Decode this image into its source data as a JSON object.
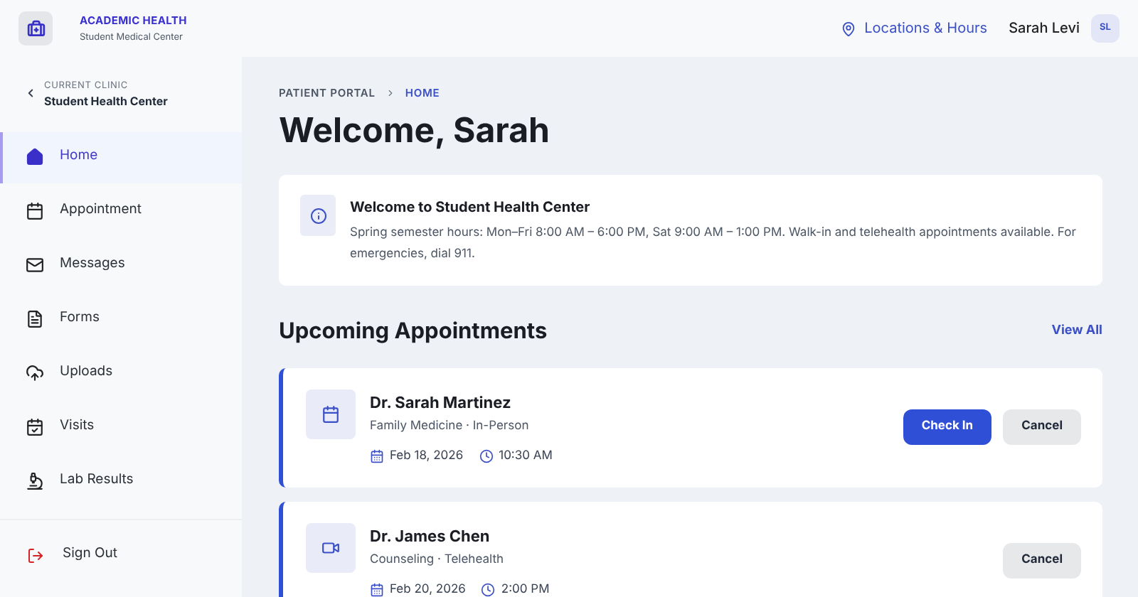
{
  "brand": {
    "name": "ACADEMIC HEALTH",
    "subtitle": "Student Medical Center"
  },
  "header": {
    "locations_link": "Locations & Hours",
    "user_name": "Sarah Levi",
    "avatar_initials": "SL"
  },
  "clinic": {
    "label": "CURRENT CLINIC",
    "name": "Student Health Center"
  },
  "sidebar": {
    "items": [
      {
        "label": "Home",
        "kind": "home",
        "selected": true
      },
      {
        "label": "Appointment",
        "kind": "appointment",
        "selected": false
      },
      {
        "label": "Messages",
        "kind": "messages",
        "selected": false
      },
      {
        "label": "Forms",
        "kind": "forms",
        "selected": false
      },
      {
        "label": "Uploads",
        "kind": "uploads",
        "selected": false
      },
      {
        "label": "Visits",
        "kind": "visits",
        "selected": false
      },
      {
        "label": "Lab Results",
        "kind": "lab",
        "selected": false
      }
    ],
    "sign_out": "Sign Out"
  },
  "breadcrumb": [
    "PATIENT PORTAL",
    "HOME"
  ],
  "title": "Welcome, Sarah",
  "notice": {
    "title": "Welcome to Student Health Center",
    "text": "Spring semester hours: Mon–Fri 8:00 AM – 6:00 PM, Sat 9:00 AM – 1:00 PM. Walk-in and telehealth appointments available. For emergencies, dial 911."
  },
  "appointments": {
    "heading": "Upcoming Appointments",
    "view_all": "View All",
    "items": [
      {
        "kind": "in-person",
        "doctor": "Dr. Sarah Martinez",
        "details": "Family Medicine · In-Person",
        "date": "Feb 18, 2026",
        "time": "10:30 AM",
        "actions": [
          {
            "label": "Check In",
            "kind": "primary"
          },
          {
            "label": "Cancel",
            "kind": "secondary"
          }
        ]
      },
      {
        "kind": "telehealth",
        "doctor": "Dr. James Chen",
        "details": "Counseling · Telehealth",
        "date": "Feb 20, 2026",
        "time": "2:00 PM",
        "actions": [
          {
            "label": "Cancel",
            "kind": "secondary"
          }
        ]
      }
    ]
  }
}
